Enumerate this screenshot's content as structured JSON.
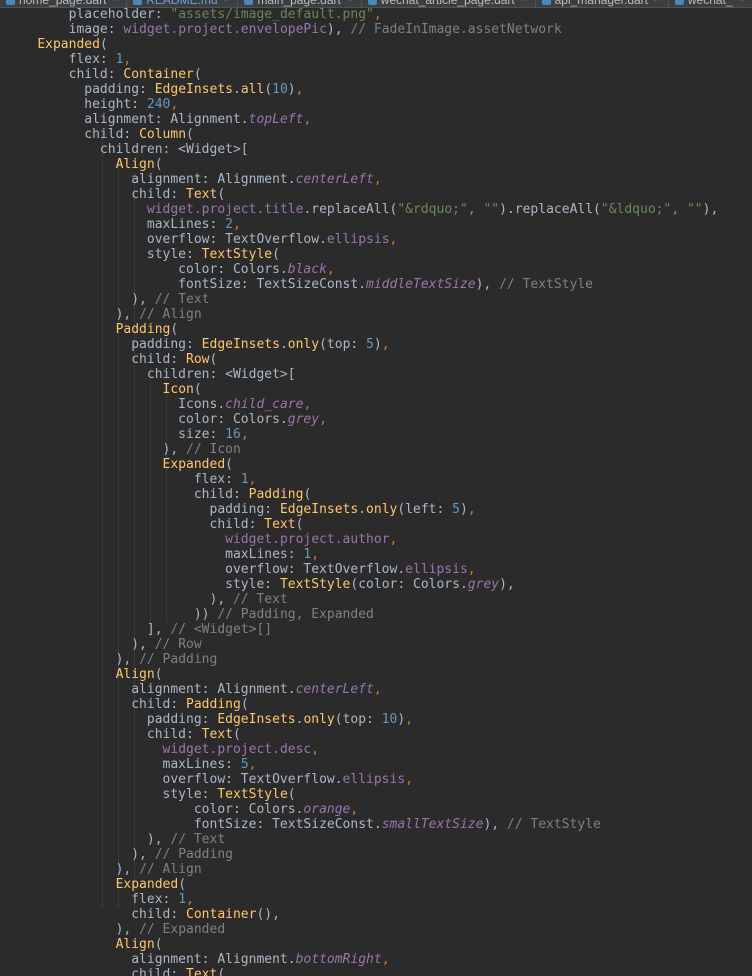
{
  "tabs": [
    {
      "label": "home_page.dart",
      "active": false
    },
    {
      "label": "README.md",
      "active": true
    },
    {
      "label": "main_page.dart",
      "active": false
    },
    {
      "label": "wechat_article_page.dart",
      "active": false
    },
    {
      "label": "api_manager.dart",
      "active": false
    },
    {
      "label": "wechat_",
      "active": false
    }
  ],
  "code_lines": [
    [
      {
        "t": "        placeholder: ",
        "c": "t"
      },
      {
        "t": "\"assets/image_default.png\"",
        "c": "s"
      },
      {
        "t": ",",
        "c": "k"
      }
    ],
    [
      {
        "t": "        image: ",
        "c": "t"
      },
      {
        "t": "widget.project.envelopePic",
        "c": "p"
      },
      {
        "t": "), ",
        "c": "t"
      },
      {
        "t": "// FadeInImage.assetNetwork",
        "c": "c"
      }
    ],
    [
      {
        "t": "    ",
        "c": "t"
      },
      {
        "t": "Expanded",
        "c": "f"
      },
      {
        "t": "(",
        "c": "t"
      }
    ],
    [
      {
        "t": "        flex: ",
        "c": "t"
      },
      {
        "t": "1",
        "c": "n"
      },
      {
        "t": ",",
        "c": "k"
      }
    ],
    [
      {
        "t": "        child: ",
        "c": "t"
      },
      {
        "t": "Container",
        "c": "f"
      },
      {
        "t": "(",
        "c": "t"
      }
    ],
    [
      {
        "t": "          padding: ",
        "c": "t"
      },
      {
        "t": "EdgeInsets",
        "c": "f"
      },
      {
        "t": ".",
        "c": "t"
      },
      {
        "t": "all",
        "c": "f"
      },
      {
        "t": "(",
        "c": "t"
      },
      {
        "t": "10",
        "c": "n"
      },
      {
        "t": ")",
        "c": "t"
      },
      {
        "t": ",",
        "c": "k"
      }
    ],
    [
      {
        "t": "          height: ",
        "c": "t"
      },
      {
        "t": "240",
        "c": "n"
      },
      {
        "t": ",",
        "c": "k"
      }
    ],
    [
      {
        "t": "          alignment: Alignment.",
        "c": "t"
      },
      {
        "t": "topLeft",
        "c": "pi"
      },
      {
        "t": ",",
        "c": "k"
      }
    ],
    [
      {
        "t": "          child: ",
        "c": "t"
      },
      {
        "t": "Column",
        "c": "f"
      },
      {
        "t": "(",
        "c": "t"
      }
    ],
    [
      {
        "t": "            children: <Widget>[",
        "c": "t"
      }
    ],
    [
      {
        "t": "              ",
        "c": "t"
      },
      {
        "t": "Align",
        "c": "f"
      },
      {
        "t": "(",
        "c": "t"
      }
    ],
    [
      {
        "t": "                alignment: Alignment.",
        "c": "t"
      },
      {
        "t": "centerLeft",
        "c": "pi"
      },
      {
        "t": ",",
        "c": "k"
      }
    ],
    [
      {
        "t": "                child: ",
        "c": "t"
      },
      {
        "t": "Text",
        "c": "f"
      },
      {
        "t": "(",
        "c": "t"
      }
    ],
    [
      {
        "t": "                  ",
        "c": "t"
      },
      {
        "t": "widget.project.title",
        "c": "p"
      },
      {
        "t": ".replaceAll(",
        "c": "t"
      },
      {
        "t": "\"&rdquo;\"",
        "c": "s"
      },
      {
        "t": ", ",
        "c": "k"
      },
      {
        "t": "\"\"",
        "c": "s"
      },
      {
        "t": ").replaceAll(",
        "c": "t"
      },
      {
        "t": "\"&ldquo;\"",
        "c": "s"
      },
      {
        "t": ", ",
        "c": "k"
      },
      {
        "t": "\"\"",
        "c": "s"
      },
      {
        "t": "),",
        "c": "t"
      }
    ],
    [
      {
        "t": "                  maxLines: ",
        "c": "t"
      },
      {
        "t": "2",
        "c": "n"
      },
      {
        "t": ",",
        "c": "k"
      }
    ],
    [
      {
        "t": "                  overflow: TextOverflow.",
        "c": "t"
      },
      {
        "t": "ellipsis",
        "c": "p"
      },
      {
        "t": ",",
        "c": "k"
      }
    ],
    [
      {
        "t": "                  style: ",
        "c": "t"
      },
      {
        "t": "TextStyle",
        "c": "f"
      },
      {
        "t": "(",
        "c": "t"
      }
    ],
    [
      {
        "t": "                      color: Colors.",
        "c": "t"
      },
      {
        "t": "black",
        "c": "pi"
      },
      {
        "t": ",",
        "c": "k"
      }
    ],
    [
      {
        "t": "                      fontSize: TextSizeConst.",
        "c": "t"
      },
      {
        "t": "middleTextSize",
        "c": "pi"
      },
      {
        "t": "), ",
        "c": "t"
      },
      {
        "t": "// TextStyle",
        "c": "c"
      }
    ],
    [
      {
        "t": "                ), ",
        "c": "t"
      },
      {
        "t": "// Text",
        "c": "c"
      }
    ],
    [
      {
        "t": "              ), ",
        "c": "t"
      },
      {
        "t": "// Align",
        "c": "c"
      }
    ],
    [
      {
        "t": "              ",
        "c": "t"
      },
      {
        "t": "Padding",
        "c": "f"
      },
      {
        "t": "(",
        "c": "t"
      }
    ],
    [
      {
        "t": "                padding: ",
        "c": "t"
      },
      {
        "t": "EdgeInsets",
        "c": "f"
      },
      {
        "t": ".",
        "c": "t"
      },
      {
        "t": "only",
        "c": "f"
      },
      {
        "t": "(top: ",
        "c": "t"
      },
      {
        "t": "5",
        "c": "n"
      },
      {
        "t": ")",
        "c": "t"
      },
      {
        "t": ",",
        "c": "k"
      }
    ],
    [
      {
        "t": "                child: ",
        "c": "t"
      },
      {
        "t": "Row",
        "c": "f"
      },
      {
        "t": "(",
        "c": "t"
      }
    ],
    [
      {
        "t": "                  children: <Widget>[",
        "c": "t"
      }
    ],
    [
      {
        "t": "                    ",
        "c": "t"
      },
      {
        "t": "Icon",
        "c": "f"
      },
      {
        "t": "(",
        "c": "t"
      }
    ],
    [
      {
        "t": "                      Icons.",
        "c": "t"
      },
      {
        "t": "child_care",
        "c": "pi"
      },
      {
        "t": ",",
        "c": "k"
      }
    ],
    [
      {
        "t": "                      color: Colors.",
        "c": "t"
      },
      {
        "t": "grey",
        "c": "pi"
      },
      {
        "t": ",",
        "c": "k"
      }
    ],
    [
      {
        "t": "                      size: ",
        "c": "t"
      },
      {
        "t": "16",
        "c": "n"
      },
      {
        "t": ",",
        "c": "k"
      }
    ],
    [
      {
        "t": "                    ), ",
        "c": "t"
      },
      {
        "t": "// Icon",
        "c": "c"
      }
    ],
    [
      {
        "t": "                    ",
        "c": "t"
      },
      {
        "t": "Expanded",
        "c": "f"
      },
      {
        "t": "(",
        "c": "t"
      }
    ],
    [
      {
        "t": "                        flex: ",
        "c": "t"
      },
      {
        "t": "1",
        "c": "n"
      },
      {
        "t": ",",
        "c": "k"
      }
    ],
    [
      {
        "t": "                        child: ",
        "c": "t"
      },
      {
        "t": "Padding",
        "c": "f"
      },
      {
        "t": "(",
        "c": "t"
      }
    ],
    [
      {
        "t": "                          padding: ",
        "c": "t"
      },
      {
        "t": "EdgeInsets",
        "c": "f"
      },
      {
        "t": ".",
        "c": "t"
      },
      {
        "t": "only",
        "c": "f"
      },
      {
        "t": "(left: ",
        "c": "t"
      },
      {
        "t": "5",
        "c": "n"
      },
      {
        "t": ")",
        "c": "t"
      },
      {
        "t": ",",
        "c": "k"
      }
    ],
    [
      {
        "t": "                          child: ",
        "c": "t"
      },
      {
        "t": "Text",
        "c": "f"
      },
      {
        "t": "(",
        "c": "t"
      }
    ],
    [
      {
        "t": "                            ",
        "c": "t"
      },
      {
        "t": "widget.project.author",
        "c": "p"
      },
      {
        "t": ",",
        "c": "k"
      }
    ],
    [
      {
        "t": "                            maxLines: ",
        "c": "t"
      },
      {
        "t": "1",
        "c": "n"
      },
      {
        "t": ",",
        "c": "k"
      }
    ],
    [
      {
        "t": "                            overflow: TextOverflow.",
        "c": "t"
      },
      {
        "t": "ellipsis",
        "c": "p"
      },
      {
        "t": ",",
        "c": "k"
      }
    ],
    [
      {
        "t": "                            style: ",
        "c": "t"
      },
      {
        "t": "TextStyle",
        "c": "f"
      },
      {
        "t": "(color: Colors.",
        "c": "t"
      },
      {
        "t": "grey",
        "c": "pi"
      },
      {
        "t": "),",
        "c": "t"
      }
    ],
    [
      {
        "t": "                          ), ",
        "c": "t"
      },
      {
        "t": "// Text",
        "c": "c"
      }
    ],
    [
      {
        "t": "                        )) ",
        "c": "t"
      },
      {
        "t": "// Padding, Expanded",
        "c": "c"
      }
    ],
    [
      {
        "t": "                  ], ",
        "c": "t"
      },
      {
        "t": "// <Widget>[]",
        "c": "c"
      }
    ],
    [
      {
        "t": "                ), ",
        "c": "t"
      },
      {
        "t": "// Row",
        "c": "c"
      }
    ],
    [
      {
        "t": "              ), ",
        "c": "t"
      },
      {
        "t": "// Padding",
        "c": "c"
      }
    ],
    [
      {
        "t": "              ",
        "c": "t"
      },
      {
        "t": "Align",
        "c": "f"
      },
      {
        "t": "(",
        "c": "t"
      }
    ],
    [
      {
        "t": "                alignment: Alignment.",
        "c": "t"
      },
      {
        "t": "centerLeft",
        "c": "pi"
      },
      {
        "t": ",",
        "c": "k"
      }
    ],
    [
      {
        "t": "                child: ",
        "c": "t"
      },
      {
        "t": "Padding",
        "c": "f"
      },
      {
        "t": "(",
        "c": "t"
      }
    ],
    [
      {
        "t": "                  padding: ",
        "c": "t"
      },
      {
        "t": "EdgeInsets",
        "c": "f"
      },
      {
        "t": ".",
        "c": "t"
      },
      {
        "t": "only",
        "c": "f"
      },
      {
        "t": "(top: ",
        "c": "t"
      },
      {
        "t": "10",
        "c": "n"
      },
      {
        "t": ")",
        "c": "t"
      },
      {
        "t": ",",
        "c": "k"
      }
    ],
    [
      {
        "t": "                  child: ",
        "c": "t"
      },
      {
        "t": "Text",
        "c": "f"
      },
      {
        "t": "(",
        "c": "t"
      }
    ],
    [
      {
        "t": "                    ",
        "c": "t"
      },
      {
        "t": "widget.project.desc",
        "c": "p"
      },
      {
        "t": ",",
        "c": "k"
      }
    ],
    [
      {
        "t": "                    maxLines: ",
        "c": "t"
      },
      {
        "t": "5",
        "c": "n"
      },
      {
        "t": ",",
        "c": "k"
      }
    ],
    [
      {
        "t": "                    overflow: TextOverflow.",
        "c": "t"
      },
      {
        "t": "ellipsis",
        "c": "p"
      },
      {
        "t": ",",
        "c": "k"
      }
    ],
    [
      {
        "t": "                    style: ",
        "c": "t"
      },
      {
        "t": "TextStyle",
        "c": "f"
      },
      {
        "t": "(",
        "c": "t"
      }
    ],
    [
      {
        "t": "                        color: Colors.",
        "c": "t"
      },
      {
        "t": "orange",
        "c": "pi"
      },
      {
        "t": ",",
        "c": "k"
      }
    ],
    [
      {
        "t": "                        fontSize: TextSizeConst.",
        "c": "t"
      },
      {
        "t": "smallTextSize",
        "c": "pi"
      },
      {
        "t": "), ",
        "c": "t"
      },
      {
        "t": "// TextStyle",
        "c": "c"
      }
    ],
    [
      {
        "t": "                  ), ",
        "c": "t"
      },
      {
        "t": "// Text",
        "c": "c"
      }
    ],
    [
      {
        "t": "                ), ",
        "c": "t"
      },
      {
        "t": "// Padding",
        "c": "c"
      }
    ],
    [
      {
        "t": "              ), ",
        "c": "t"
      },
      {
        "t": "// Align",
        "c": "c"
      }
    ],
    [
      {
        "t": "              ",
        "c": "t"
      },
      {
        "t": "Expanded",
        "c": "f"
      },
      {
        "t": "(",
        "c": "t"
      }
    ],
    [
      {
        "t": "                flex: ",
        "c": "t"
      },
      {
        "t": "1",
        "c": "n"
      },
      {
        "t": ",",
        "c": "k"
      }
    ],
    [
      {
        "t": "                child: ",
        "c": "t"
      },
      {
        "t": "Container",
        "c": "f"
      },
      {
        "t": "(),",
        "c": "t"
      }
    ],
    [
      {
        "t": "              ), ",
        "c": "t"
      },
      {
        "t": "// Expanded",
        "c": "c"
      }
    ],
    [
      {
        "t": "              ",
        "c": "t"
      },
      {
        "t": "Align",
        "c": "f"
      },
      {
        "t": "(",
        "c": "t"
      }
    ],
    [
      {
        "t": "                alignment: Alignment.",
        "c": "t"
      },
      {
        "t": "bottomRight",
        "c": "pi"
      },
      {
        "t": ",",
        "c": "k"
      }
    ],
    [
      {
        "t": "                child: ",
        "c": "t"
      },
      {
        "t": "Text",
        "c": "f"
      },
      {
        "t": "(",
        "c": "t"
      }
    ]
  ]
}
